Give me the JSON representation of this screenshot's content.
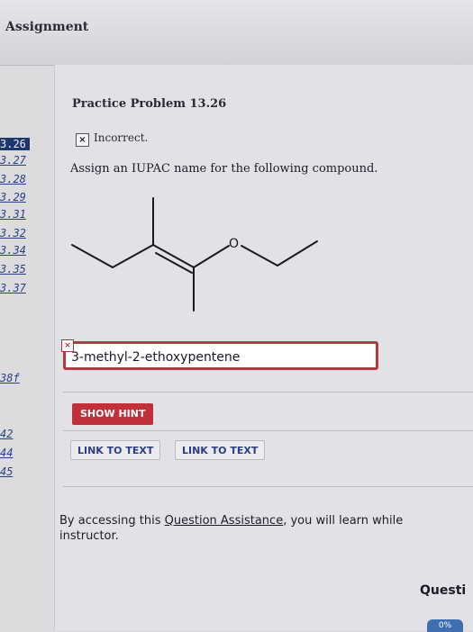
{
  "header": {
    "title": "Assignment"
  },
  "sidebar": {
    "items": [
      {
        "label": "3.26",
        "active": true
      },
      {
        "label": "3.27"
      },
      {
        "label": "3.28"
      },
      {
        "label": "3.29"
      },
      {
        "label": "3.31"
      },
      {
        "label": "3.32"
      },
      {
        "label": "3.34"
      },
      {
        "label": "3.35"
      },
      {
        "label": "3.37"
      },
      {
        "label": "38f"
      },
      {
        "label": "42"
      },
      {
        "label": "44"
      },
      {
        "label": "45"
      }
    ]
  },
  "problem": {
    "title": "Practice Problem 13.26",
    "status_icon": "x-box-icon",
    "status_text": "Incorrect.",
    "question": "Assign an IUPAC name for the following compound.",
    "molecule_atom_label": "O"
  },
  "answer": {
    "value": "3-methyl-2-ethoxypentene",
    "mark": "×"
  },
  "buttons": {
    "show_hint": "SHOW HINT",
    "link_to_text_1": "LINK TO TEXT",
    "link_to_text_2": "LINK TO TEXT"
  },
  "assistance": {
    "prefix": "By accessing this ",
    "link": "Question Assistance",
    "suffix": ", you will learn while",
    "line2": "instructor."
  },
  "footer": {
    "question_link": "Questi",
    "badge": "0%"
  },
  "colors": {
    "accent_red": "#c0313a",
    "link_blue": "#2a3f86",
    "active_navy": "#1f356e"
  }
}
